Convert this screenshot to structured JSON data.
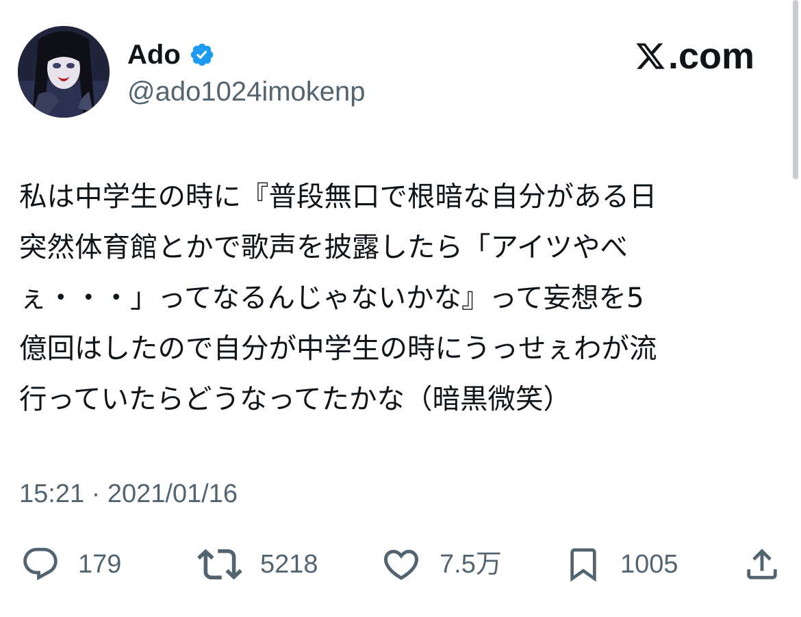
{
  "author": {
    "display_name": "Ado",
    "handle": "@ado1024imokenp",
    "verified": true,
    "verified_color": "#1d9bf0"
  },
  "brand": {
    "label": ".com",
    "icon": "x-logo-icon"
  },
  "tweet": {
    "lines": [
      "私は中学生の時に『普段無口で根暗な自分がある日",
      "突然体育館とかで歌声を披露したら「アイツやべ",
      "ぇ・・・」ってなるんじゃないかな』って妄想を5",
      "億回はしたので自分が中学生の時にうっせぇわが流",
      "行っていたらどうなってたかな（暗黒微笑）"
    ],
    "timestamp": "15:21 · 2021/01/16"
  },
  "actions": {
    "reply": {
      "icon": "reply-icon",
      "count": "179"
    },
    "retweet": {
      "icon": "retweet-icon",
      "count": "5218"
    },
    "like": {
      "icon": "heart-icon",
      "count": "7.5万"
    },
    "bookmark": {
      "icon": "bookmark-icon",
      "count": "1005"
    },
    "share": {
      "icon": "share-icon"
    }
  },
  "colors": {
    "text_primary": "#0f1419",
    "text_secondary": "#536471",
    "icon_gray": "#536471"
  }
}
